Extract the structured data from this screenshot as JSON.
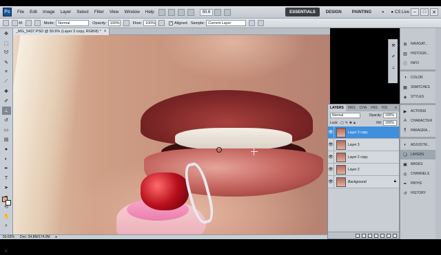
{
  "menu": {
    "logo": "Ps",
    "items": [
      "File",
      "Edit",
      "Image",
      "Layer",
      "Select",
      "Filter",
      "View",
      "Window",
      "Help"
    ],
    "zoom": "50.6",
    "workspaces": [
      "ESSENTIALS",
      "DESIGN",
      "PAINTING"
    ],
    "more": "»",
    "cslive": "CS Live",
    "window_controls": [
      "–",
      "□",
      "✕"
    ]
  },
  "options": {
    "brush_size": "45",
    "mode_label": "Mode:",
    "mode_value": "Normal",
    "opacity_label": "Opacity:",
    "opacity_value": "100%",
    "flow_label": "Flow:",
    "flow_value": "100%",
    "aligned_label": "Aligned",
    "sample_label": "Sample:",
    "sample_value": "Current Layer"
  },
  "document": {
    "tab_title": "_MG_5437.PSD @ 50.6% (Layer 3 copy, RGB/8) *",
    "close": "×"
  },
  "status": {
    "zoom": "50.63%",
    "doc": "Doc: 34.8M/174.0M"
  },
  "layers_panel": {
    "tabs": [
      "LAYERS",
      "MAS",
      "CHA",
      "PAS",
      "HIS"
    ],
    "blend": "Normal",
    "opacity_label": "Opacity:",
    "opacity_value": "100%",
    "lock_label": "Lock:",
    "fill_label": "Fill:",
    "fill_value": "100%",
    "layers": [
      "Layer 3 copy",
      "Layer 3",
      "Layer 2 copy",
      "Layer 2",
      "Background"
    ]
  },
  "dock": {
    "group1": [
      "NAVIGAT...",
      "HISTOGR...",
      "INFO"
    ],
    "group2": [
      "COLOR",
      "SWATCHES",
      "STYLES"
    ],
    "group3": [
      "ACTIONS",
      "CHARACTER",
      "PARAGRA..."
    ],
    "group4": [
      "ADJUSTM...",
      "LAYERS",
      "MASKS",
      "CHANNELS",
      "PATHS",
      "HISTORY"
    ]
  },
  "colors": {
    "selected_layer": "#3f8fdd",
    "workspace_active": "#3b3f45",
    "foreground": "#f1a58a",
    "background": "#ffffff"
  }
}
